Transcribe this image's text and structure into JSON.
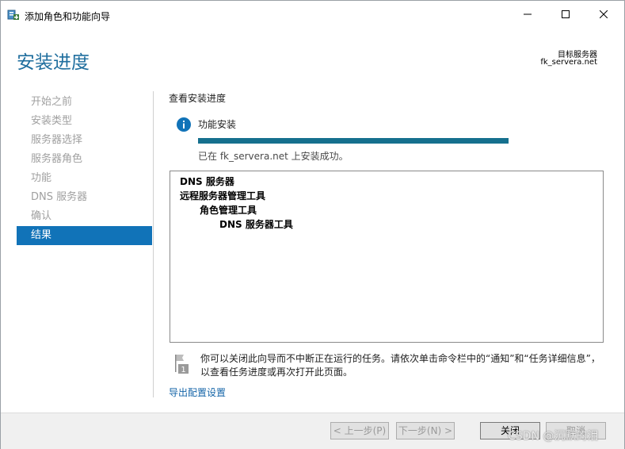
{
  "window": {
    "title": "添加角色和功能向导",
    "icon": "server-manager-icon"
  },
  "header": {
    "heading": "安装进度",
    "target_label": "目标服务器",
    "target_value": "fk_servera.net"
  },
  "nav": {
    "items": [
      {
        "label": "开始之前",
        "active": false
      },
      {
        "label": "安装类型",
        "active": false
      },
      {
        "label": "服务器选择",
        "active": false
      },
      {
        "label": "服务器角色",
        "active": false
      },
      {
        "label": "功能",
        "active": false
      },
      {
        "label": "DNS 服务器",
        "active": false
      },
      {
        "label": "确认",
        "active": false
      },
      {
        "label": "结果",
        "active": true
      }
    ]
  },
  "content": {
    "section_title": "查看安装进度",
    "feature_label": "功能安装",
    "progress": 1.0,
    "status": "已在 fk_servera.net 上安装成功。",
    "results": [
      {
        "text": "DNS 服务器",
        "level": 0
      },
      {
        "text": "远程服务器管理工具",
        "level": 0
      },
      {
        "text": "角色管理工具",
        "level": 1
      },
      {
        "text": "DNS 服务器工具",
        "level": 2
      }
    ],
    "note": "你可以关闭此向导而不中断正在运行的任务。请依次单击命令栏中的“通知”和“任务详细信息”，以查看任务进度或再次打开此页面。",
    "note_badge": "1",
    "export_link": "导出配置设置"
  },
  "footer": {
    "prev_label": "< 上一步(P)",
    "next_label": "下一步(N) >",
    "close_label": "关闭",
    "cancel_label": "取消",
    "watermark": "CSDN @沉默的泪"
  },
  "colors": {
    "accent": "#1173b8",
    "heading": "#1f6e9e",
    "progress": "#15708e",
    "link": "#1565a8"
  }
}
